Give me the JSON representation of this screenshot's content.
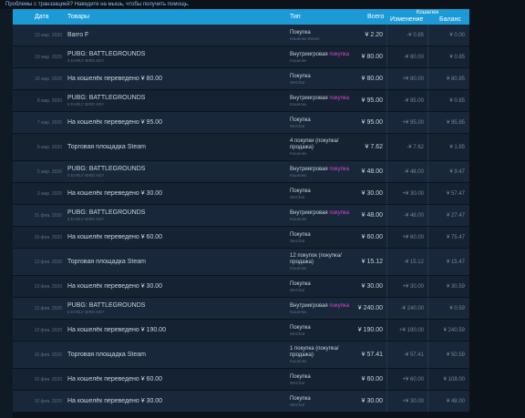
{
  "top_text": "Проблемы с транзакцией? Наведите на мышь, чтобы получить помощь.",
  "header": {
    "date": "Дата",
    "items": "Товары",
    "type": "Тип",
    "total": "Всего",
    "wallet": "Кошелек",
    "change": "Изменение",
    "balance": "Баланс"
  },
  "rows": [
    {
      "date": "23 мар. 2020",
      "title": "Barro F",
      "subtitle": "",
      "type_pre": "Покупка",
      "type_accent": "",
      "type_sub": "Кошелек Steam",
      "type_sub2": "",
      "total": "¥ 2.20",
      "change": "-¥ 0.85",
      "balance": "¥ 0.00",
      "h": 23
    },
    {
      "date": "19 мар. 2020",
      "title": "PUBG: BATTLEGROUNDS",
      "subtitle": "5 EARLY BIRD KEY",
      "type_pre": "Внутриигровая ",
      "type_accent": "покупка",
      "type_sub": "Кошелек",
      "type_sub2": "",
      "total": "¥ 80.00",
      "change": "-¥ 80.00",
      "balance": "¥ 0.85",
      "h": 23
    },
    {
      "date": "18 мар. 2020",
      "title": "На кошелёк переведено ¥ 80.00",
      "subtitle": "",
      "type_pre": "Покупка",
      "type_accent": "",
      "type_sub": "WeChat",
      "type_sub2": "",
      "total": "¥ 80.00",
      "change": "+¥ 80.00",
      "balance": "¥ 80.85",
      "h": 23
    },
    {
      "date": "8 мар. 2020",
      "title": "PUBG: BATTLEGROUNDS",
      "subtitle": "5 EARLY BIRD KEY",
      "type_pre": "Внутриигровая ",
      "type_accent": "покупка",
      "type_sub": "Кошелек",
      "type_sub2": "",
      "total": "¥ 95.00",
      "change": "-¥ 95.00",
      "balance": "¥ 0.85",
      "h": 23
    },
    {
      "date": "7 мар. 2020",
      "title": "На кошелёк переведено ¥ 95.00",
      "subtitle": "",
      "type_pre": "Покупка",
      "type_accent": "",
      "type_sub": "WeChat",
      "type_sub2": "",
      "total": "¥ 95.00",
      "change": "+¥ 95.00",
      "balance": "¥ 95.85",
      "h": 23
    },
    {
      "date": "5 мар. 2020",
      "title": "Торговая площадка Steam",
      "subtitle": "",
      "type_pre": "4 покупки (покупка/продажа)",
      "type_accent": "",
      "type_sub": "Кошелек",
      "type_sub2": "",
      "total": "¥ 7.62",
      "change": "-¥ 7.62",
      "balance": "¥ 1.85",
      "h": 29
    },
    {
      "date": "5 мар. 2020",
      "title": "PUBG: BATTLEGROUNDS",
      "subtitle": "5 EARLY BIRD KEY",
      "type_pre": "Внутриигровая ",
      "type_accent": "покупка",
      "type_sub": "Кошелек",
      "type_sub2": "",
      "total": "¥ 48.00",
      "change": "-¥ 48.00",
      "balance": "¥ 9.47",
      "h": 23
    },
    {
      "date": "3 мар. 2020",
      "title": "На кошелёк переведено ¥ 30.00",
      "subtitle": "",
      "type_pre": "Покупка",
      "type_accent": "",
      "type_sub": "WeChat",
      "type_sub2": "",
      "total": "¥ 30.00",
      "change": "+¥ 30.00",
      "balance": "¥ 57.47",
      "h": 23
    },
    {
      "date": "21 фев. 2020",
      "title": "PUBG: BATTLEGROUNDS",
      "subtitle": "5 EARLY BIRD KEY",
      "type_pre": "Внутриигровая ",
      "type_accent": "покупка",
      "type_sub": "Кошелек",
      "type_sub2": "",
      "total": "¥ 48.00",
      "change": "-¥ 48.00",
      "balance": "¥ 27.47",
      "h": 23
    },
    {
      "date": "19 фев. 2020",
      "title": "На кошелёк переведено ¥ 60.00",
      "subtitle": "",
      "type_pre": "Покупка",
      "type_accent": "",
      "type_sub": "WeChat",
      "type_sub2": "",
      "total": "¥ 60.00",
      "change": "+¥ 60.00",
      "balance": "¥ 75.47",
      "h": 23
    },
    {
      "date": "13 фев. 2020",
      "title": "Торговая площадка Steam",
      "subtitle": "",
      "type_pre": "12 покупок (покупка/продажа)",
      "type_accent": "",
      "type_sub": "Кошелек",
      "type_sub2": "",
      "total": "¥ 15.12",
      "change": "-¥ 15.12",
      "balance": "¥ 15.47",
      "h": 29
    },
    {
      "date": "13 фев. 2020",
      "title": "На кошелёк переведено ¥ 30.00",
      "subtitle": "",
      "type_pre": "Покупка",
      "type_accent": "",
      "type_sub": "WeChat",
      "type_sub2": "",
      "total": "¥ 30.00",
      "change": "+¥ 30.00",
      "balance": "¥ 30.59",
      "h": 23
    },
    {
      "date": "12 фев. 2020",
      "title": "PUBG: BATTLEGROUNDS",
      "subtitle": "5 EARLY BIRD KEY",
      "type_pre": "Внутриигровая ",
      "type_accent": "покупка",
      "type_sub": "Кошелек",
      "type_sub2": "",
      "total": "¥ 240.00",
      "change": "-¥ 240.00",
      "balance": "¥ 0.59",
      "h": 23
    },
    {
      "date": "12 фев. 2020",
      "title": "На кошелёк переведено ¥ 190.00",
      "subtitle": "",
      "type_pre": "Покупка",
      "type_accent": "",
      "type_sub": "WeChat",
      "type_sub2": "",
      "total": "¥ 190.00",
      "change": "+¥ 190.00",
      "balance": "¥ 240.59",
      "h": 23
    },
    {
      "date": "10 фев. 2020",
      "title": "Торговая площадка Steam",
      "subtitle": "",
      "type_pre": "1 покупка (покупка/продажа)",
      "type_accent": "",
      "type_sub": "Кошелек",
      "type_sub2": "",
      "total": "¥ 57.41",
      "change": "-¥ 57.41",
      "balance": "¥ 50.59",
      "h": 29
    },
    {
      "date": "10 фев. 2020",
      "title": "На кошелёк переведено ¥ 60.00",
      "subtitle": "",
      "type_pre": "Покупка",
      "type_accent": "",
      "type_sub": "WeChat",
      "type_sub2": "",
      "total": "¥ 60.00",
      "change": "+¥ 60.00",
      "balance": "¥ 108.00",
      "h": 23
    },
    {
      "date": "10 фев. 2020",
      "title": "На кошелёк переведено ¥ 30.00",
      "subtitle": "",
      "type_pre": "Покупка",
      "type_accent": "",
      "type_sub": "WeChat",
      "type_sub2": "",
      "total": "¥ 30.00",
      "change": "+¥ 30.00",
      "balance": "¥ 48.00",
      "h": 23
    }
  ]
}
